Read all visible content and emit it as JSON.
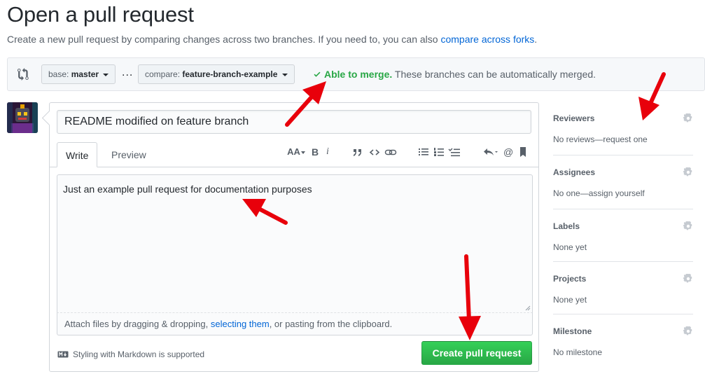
{
  "page": {
    "title": "Open a pull request",
    "subtitle_prefix": "Create a new pull request by comparing changes across two branches. If you need to, you can also ",
    "subtitle_link": "compare across forks",
    "subtitle_suffix": "."
  },
  "compare": {
    "base_prefix": "base:",
    "base_value": "master",
    "ellipsis": "...",
    "compare_prefix": "compare:",
    "compare_value": "feature-branch-example",
    "merge_ok": "Able to merge.",
    "merge_text": "These branches can be automatically merged."
  },
  "form": {
    "title_value": "README modified on feature branch",
    "tab_write": "Write",
    "tab_preview": "Preview",
    "heading_tool": "AA",
    "bold_tool": "B",
    "italic_tool": "i",
    "mention_tool": "@",
    "body_value": "Just an example pull request for documentation purposes",
    "attach_prefix": "Attach files by dragging & dropping, ",
    "attach_link": "selecting them",
    "attach_suffix": ", or pasting from the clipboard.",
    "markdown_note": "Styling with Markdown is supported",
    "create_label": "Create pull request"
  },
  "sidebar": {
    "sections": [
      {
        "heading": "Reviewers",
        "value": "No reviews—request one"
      },
      {
        "heading": "Assignees",
        "value": "No one—assign yourself"
      },
      {
        "heading": "Labels",
        "value": "None yet"
      },
      {
        "heading": "Projects",
        "value": "None yet"
      },
      {
        "heading": "Milestone",
        "value": "No milestone"
      }
    ]
  },
  "colors": {
    "accent_link": "#0366d6",
    "success": "#28a745",
    "annotation_arrow": "#e8000b"
  },
  "icons": [
    "compare-icon",
    "check-icon",
    "gear-icon",
    "markdown-icon",
    "quote-icon",
    "code-icon",
    "link-icon",
    "bullet-list-icon",
    "numbered-list-icon",
    "task-list-icon",
    "reply-icon",
    "mention-icon",
    "bookmark-icon"
  ]
}
